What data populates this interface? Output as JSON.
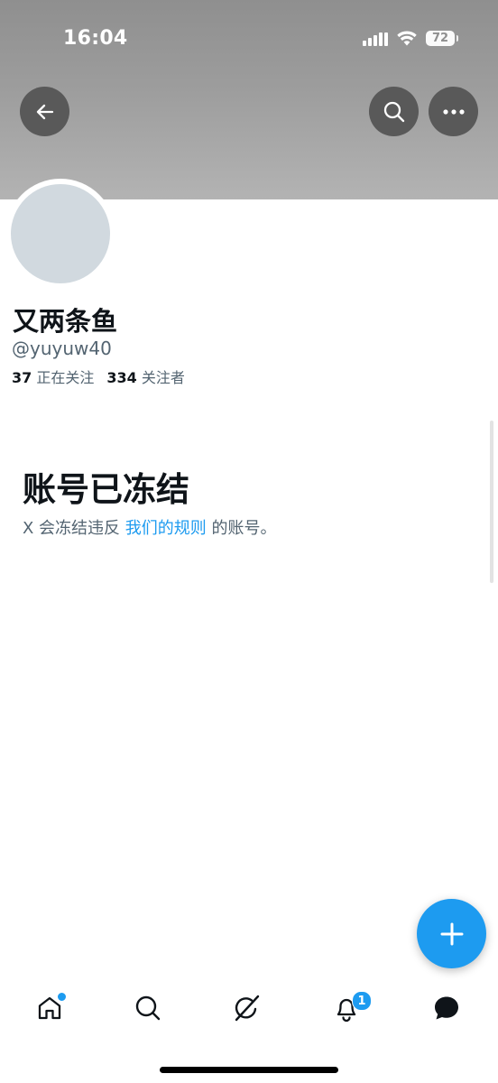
{
  "status_bar": {
    "time": "16:04",
    "battery": "72"
  },
  "header": {
    "back_icon": "arrow-left-icon",
    "search_icon": "search-icon",
    "more_icon": "more-horizontal-icon"
  },
  "profile": {
    "display_name": "又两条鱼",
    "handle": "@yuyuw40",
    "following_count": "37",
    "following_label": "正在关注",
    "followers_count": "334",
    "followers_label": "关注者"
  },
  "suspended": {
    "title": "账号已冻结",
    "text_before": "X 会冻结违反 ",
    "link_text": "我们的规则",
    "text_after": " 的账号。"
  },
  "colors": {
    "accent": "#1d9bf0",
    "avatar_placeholder": "#d1d9df",
    "secondary_text": "#536471"
  },
  "tab_bar": {
    "items": [
      {
        "icon": "home-icon",
        "has_dot": true
      },
      {
        "icon": "search-icon"
      },
      {
        "icon": "grok-icon"
      },
      {
        "icon": "bell-icon",
        "badge": "1"
      },
      {
        "icon": "messages-icon"
      }
    ],
    "notifications_badge": "1"
  },
  "fab": {
    "icon": "plus-icon"
  }
}
